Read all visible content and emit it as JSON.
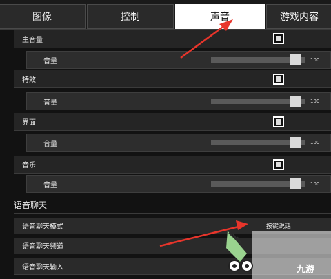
{
  "tabs": [
    {
      "label": "图像",
      "active": false
    },
    {
      "label": "控制",
      "active": false
    },
    {
      "label": "声音",
      "active": true
    },
    {
      "label": "游戏内容",
      "active": false
    }
  ],
  "audio": {
    "master": {
      "label": "主音量",
      "checked": true,
      "volume_label": "音量",
      "value": "100",
      "level": 1.0
    },
    "effects": {
      "label": "特效",
      "checked": true,
      "volume_label": "音量",
      "value": "100",
      "level": 1.0
    },
    "interface": {
      "label": "界面",
      "checked": true,
      "volume_label": "音量",
      "value": "100",
      "level": 1.0
    },
    "music": {
      "label": "音乐",
      "checked": true,
      "volume_label": "音量",
      "value": "100",
      "level": 1.0
    }
  },
  "voice_chat": {
    "heading": "语音聊天",
    "mode_label": "语音聊天模式",
    "mode_value": "按键说话",
    "channel_label": "语音聊天频道",
    "input_label": "语音聊天输入"
  },
  "watermark": {
    "text": "九游"
  },
  "colors": {
    "annotation_arrow": "#e8352b",
    "active_tab_bg": "#ffffff",
    "checkbox_border": "#ffffff"
  }
}
